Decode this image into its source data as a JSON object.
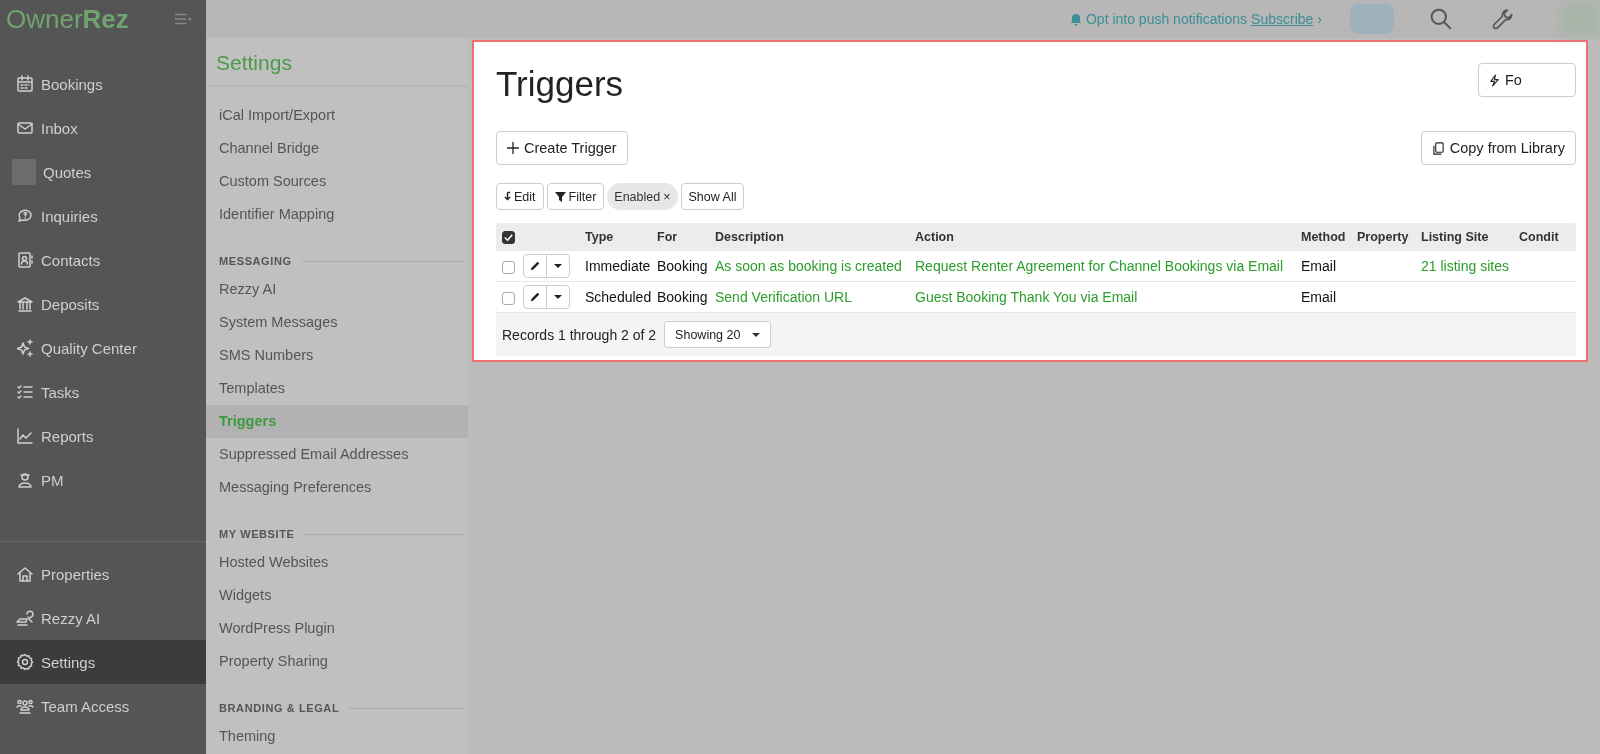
{
  "logo": "Owner**Rez**",
  "top_bar": {
    "notice": "Opt into push notifications",
    "link": "Subscribe",
    "link_chevron": "›"
  },
  "sidebar": {
    "items": [
      {
        "label": "Bookings",
        "selected": false
      },
      {
        "label": "Inbox",
        "selected": false
      },
      {
        "label": "Quotes",
        "selected": false
      },
      {
        "label": "Inquiries",
        "selected": false
      },
      {
        "label": "Contacts",
        "selected": false
      },
      {
        "label": "Deposits",
        "selected": false
      },
      {
        "label": "Quality Center",
        "selected": false
      },
      {
        "label": "Tasks",
        "selected": false
      },
      {
        "label": "Reports",
        "selected": false
      },
      {
        "label": "PM",
        "selected": false
      }
    ],
    "bottom_items": [
      {
        "label": "Properties",
        "selected": false
      },
      {
        "label": "Rezzy AI",
        "selected": false
      },
      {
        "label": "Settings",
        "selected": true
      },
      {
        "label": "Team Access",
        "selected": false
      }
    ]
  },
  "settings_nav": {
    "title": "Settings",
    "sections": [
      {
        "items": [
          {
            "label": "iCal Import/Export",
            "selected": false
          },
          {
            "label": "Channel Bridge",
            "selected": false
          },
          {
            "label": "Custom Sources",
            "selected": false
          },
          {
            "label": "Identifier Mapping",
            "selected": false
          }
        ]
      },
      {
        "heading": "MESSAGING",
        "items": [
          {
            "label": "Rezzy AI",
            "selected": false
          },
          {
            "label": "System Messages",
            "selected": false
          },
          {
            "label": "SMS Numbers",
            "selected": false
          },
          {
            "label": "Templates",
            "selected": false
          },
          {
            "label": "Triggers",
            "selected": true
          },
          {
            "label": "Suppressed Email Addresses",
            "selected": false
          },
          {
            "label": "Messaging Preferences",
            "selected": false
          }
        ]
      },
      {
        "heading": "MY WEBSITE",
        "items": [
          {
            "label": "Hosted Websites",
            "selected": false
          },
          {
            "label": "Widgets",
            "selected": false
          },
          {
            "label": "WordPress Plugin",
            "selected": false
          },
          {
            "label": "Property Sharing",
            "selected": false
          }
        ]
      },
      {
        "heading": "BRANDING & LEGAL",
        "items": [
          {
            "label": "Theming",
            "selected": false
          }
        ]
      }
    ]
  },
  "triggers": {
    "title": "Triggers",
    "corner_button": "Fo",
    "create_button": "Create Trigger",
    "library_button": "Copy from Library",
    "toolbar": {
      "edit": "Edit",
      "filter": "Filter",
      "chip": "Enabled",
      "chip_close": "×",
      "show_all": "Show All"
    },
    "table": {
      "header_checked": true,
      "columns": [
        {
          "label": "Type",
          "kind": "text"
        },
        {
          "label": "For",
          "kind": "text"
        },
        {
          "label": "Description",
          "kind": "link"
        },
        {
          "label": "Action",
          "kind": "link"
        },
        {
          "label": "Method",
          "kind": "text"
        },
        {
          "label": "Property",
          "kind": "text"
        },
        {
          "label": "Listing Site",
          "kind": "link"
        },
        {
          "label": "Condit",
          "kind": "text"
        }
      ],
      "rows": [
        {
          "checked": false,
          "cells": [
            "Immediate",
            "Booking",
            "As soon as booking is created",
            "Request Renter Agreement for Channel Bookings via Email",
            "Email",
            null,
            "21 listing sites",
            null
          ]
        },
        {
          "checked": false,
          "cells": [
            "Scheduled",
            "Booking",
            "Send Verification URL",
            "Guest Booking Thank You via Email",
            "Email",
            null,
            null,
            null
          ]
        }
      ]
    },
    "footer": {
      "records": "Records 1 through 2 of 2",
      "page_size": "Showing 20"
    }
  }
}
